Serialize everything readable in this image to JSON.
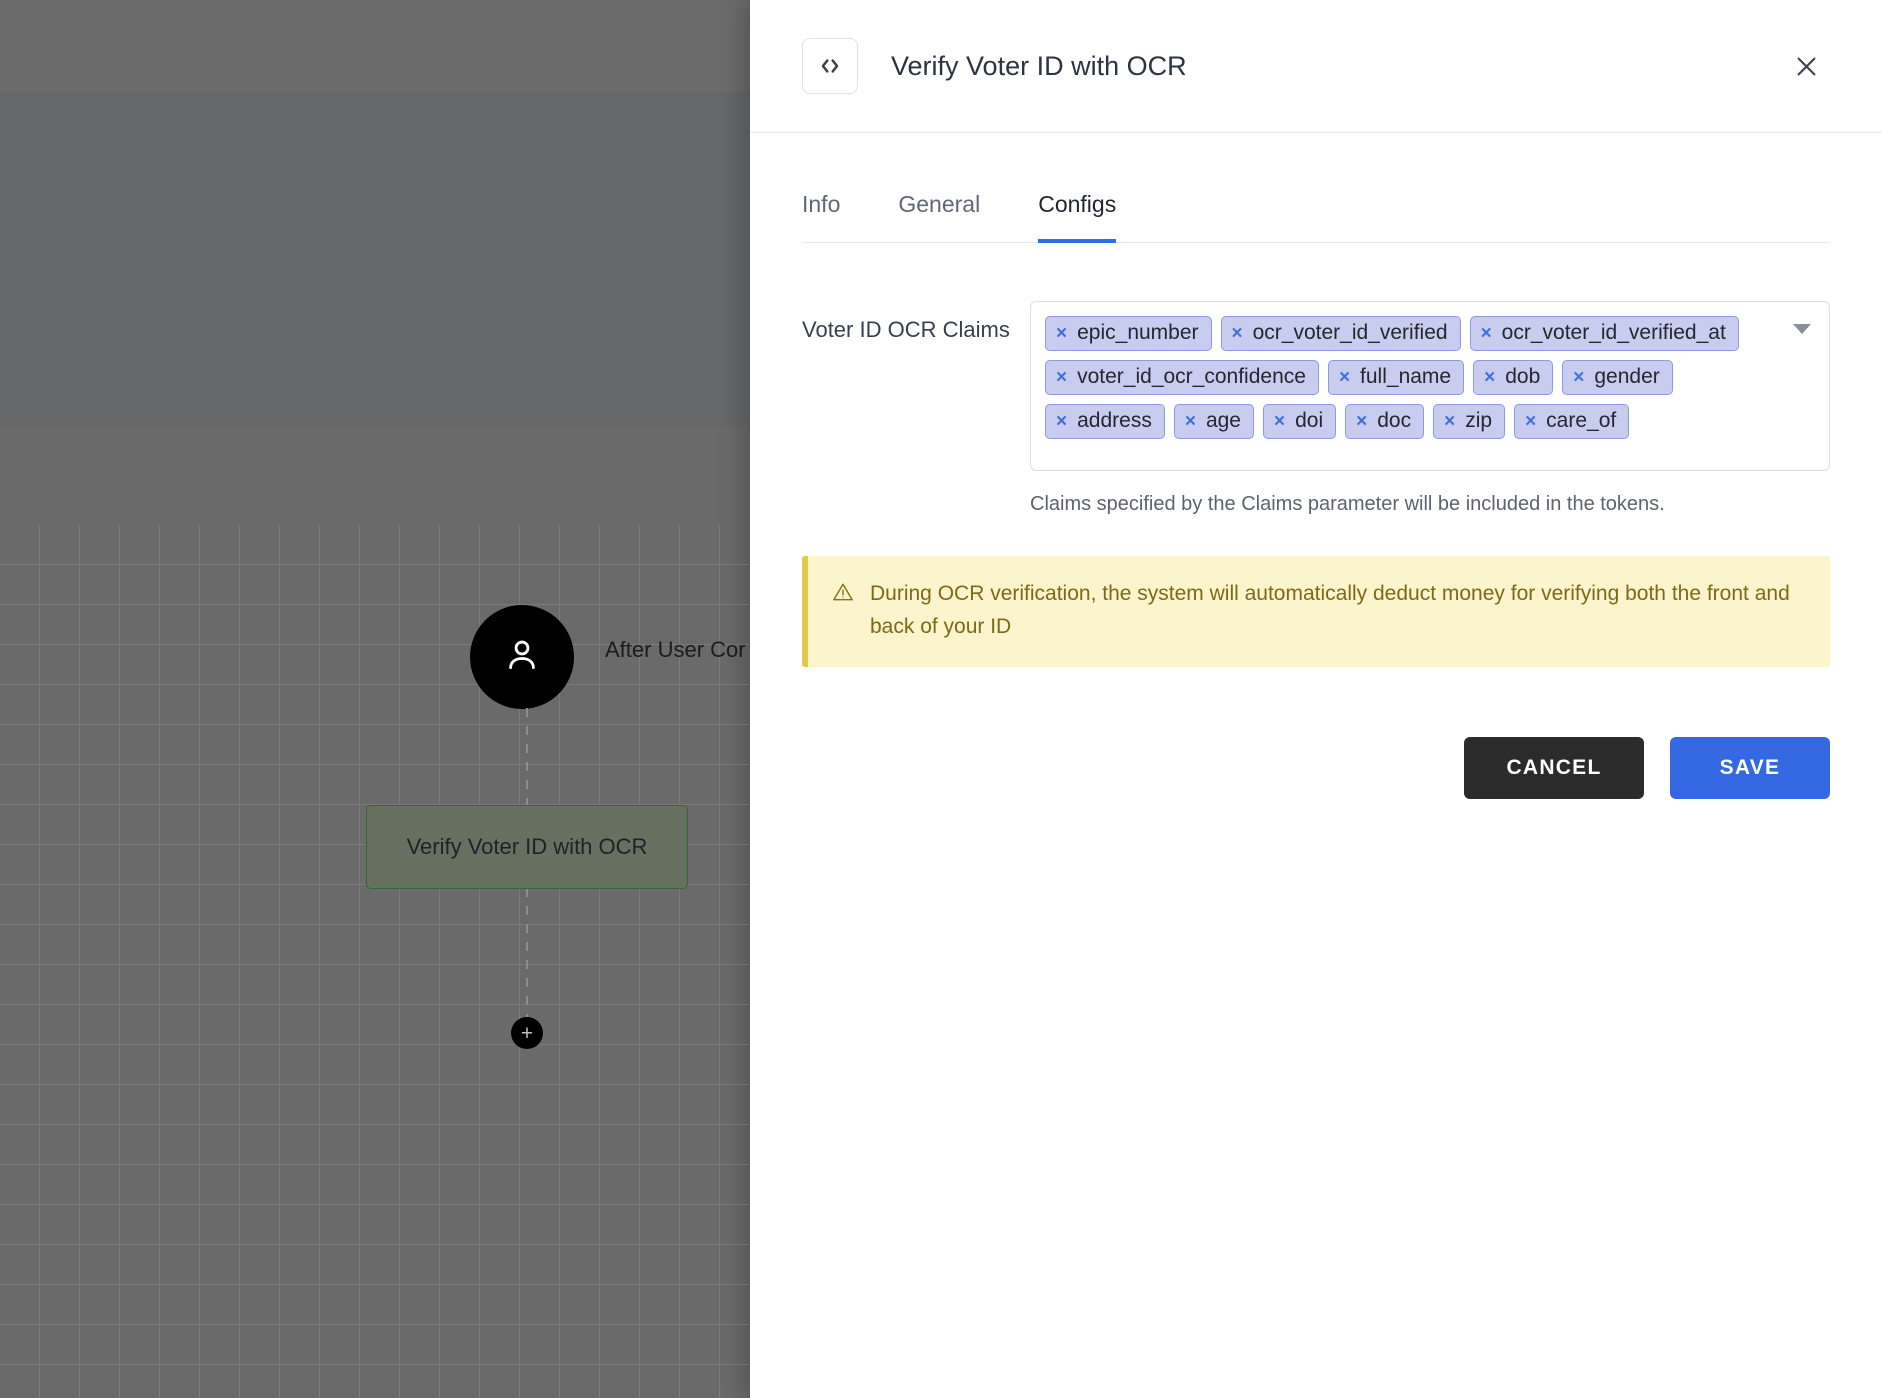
{
  "canvas": {
    "avatar_icon": "user-icon",
    "connector_label": "After User Cor",
    "node_label": "Verify Voter ID with OCR",
    "add_node_label": "+"
  },
  "panel": {
    "icon": "code-brackets-icon",
    "title": "Verify Voter ID with OCR",
    "close_icon": "close-icon"
  },
  "tabs": [
    {
      "label": "Info",
      "active": false
    },
    {
      "label": "General",
      "active": false
    },
    {
      "label": "Configs",
      "active": true
    }
  ],
  "form": {
    "claims_label": "Voter ID OCR Claims",
    "claims_chips": [
      "epic_number",
      "ocr_voter_id_verified",
      "ocr_voter_id_verified_at",
      "voter_id_ocr_confidence",
      "full_name",
      "dob",
      "gender",
      "address",
      "age",
      "doi",
      "doc",
      "zip",
      "care_of"
    ],
    "chip_remove_glyph": "×",
    "help_text": "Claims specified by the Claims parameter will be included in the tokens."
  },
  "alert": {
    "icon": "warning-triangle-icon",
    "text": "During OCR verification, the system will automatically deduct money for verifying both the front and back of your ID"
  },
  "actions": {
    "cancel_label": "CANCEL",
    "save_label": "SAVE"
  },
  "colors": {
    "accent_blue": "#2f6fed",
    "save_button": "#3468e3",
    "cancel_button": "#2b2b2b",
    "chip_background": "#c8cdf0",
    "chip_border": "#8e9ae0",
    "chip_x": "#3f6fe0",
    "alert_background": "#fcf4cd",
    "alert_border": "#e2c94a",
    "alert_text": "#7d6a17",
    "node_fill": "#66705f",
    "node_border": "#2e6b32"
  }
}
